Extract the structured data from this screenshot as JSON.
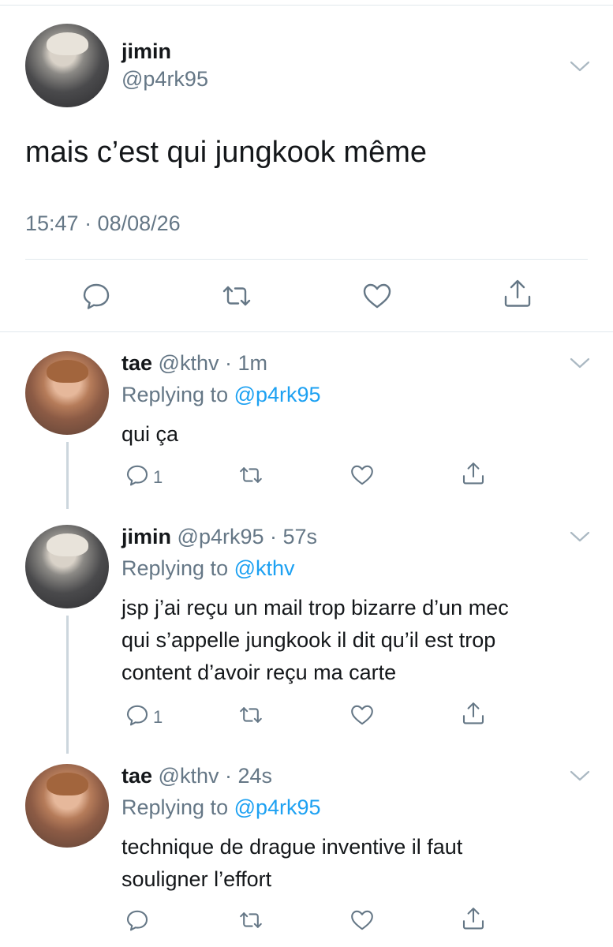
{
  "main_tweet": {
    "name": "jimin",
    "handle": "@p4rk95",
    "text": "mais c’est qui jungkook même",
    "timestamp": "15:47 · 08/08/26",
    "icons": [
      "chevron-down",
      "reply",
      "retweet",
      "like",
      "share"
    ]
  },
  "replies": [
    {
      "name": "tae",
      "handle": "@kthv",
      "time": "· 1m",
      "replying_label": "Replying to",
      "replying_to": "@p4rk95",
      "text": "qui ça",
      "reply_count": "1"
    },
    {
      "name": "jimin",
      "handle": "@p4rk95",
      "time": "· 57s",
      "replying_label": "Replying to",
      "replying_to": "@kthv",
      "text_lines": [
        "jsp j’ai reçu un mail trop bizarre d’un mec",
        "qui s’appelle jungkook il dit qu’il est trop",
        "content d’avoir reçu ma carte"
      ],
      "reply_count": "1"
    },
    {
      "name": "tae",
      "handle": "@kthv",
      "time": "· 24s",
      "replying_label": "Replying to",
      "replying_to": "@p4rk95",
      "text_lines": [
        "technique de drague inventive il faut",
        "souligner l’effort"
      ],
      "reply_count": ""
    }
  ],
  "colors": {
    "link": "#1da1f2",
    "secondary": "#657786",
    "divider": "#e1e8ed"
  }
}
